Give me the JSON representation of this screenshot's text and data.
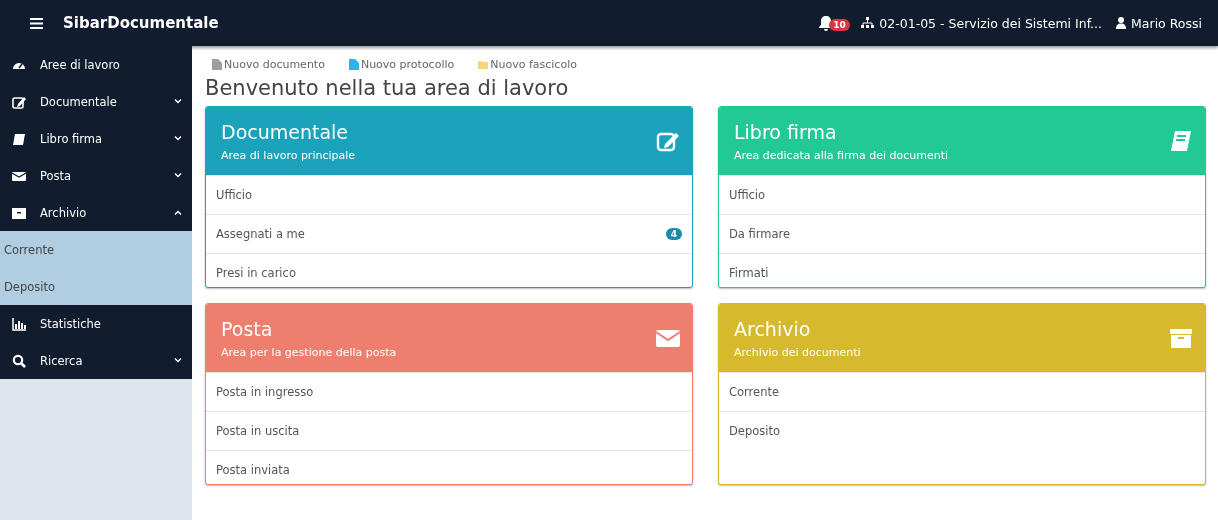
{
  "topbar": {
    "brand": "SibarDocumentale",
    "notifications": "10",
    "office": "02-01-05 - Servizio dei Sistemi Inf...",
    "user": "Mario Rossi"
  },
  "sidebar": {
    "items": [
      {
        "label": "Aree di lavoro"
      },
      {
        "label": "Documentale",
        "expanded": false
      },
      {
        "label": "Libro firma",
        "expanded": false
      },
      {
        "label": "Posta",
        "expanded": false
      },
      {
        "label": "Archivio",
        "expanded": true,
        "children": [
          {
            "label": "Corrente"
          },
          {
            "label": "Deposito"
          }
        ]
      },
      {
        "label": "Statistiche"
      },
      {
        "label": "Ricerca",
        "expanded": false
      }
    ]
  },
  "quick_actions": [
    {
      "label": "Nuovo documento",
      "color": "#9e9e9e"
    },
    {
      "label": "Nuovo protocollo",
      "color": "#29b6e6"
    },
    {
      "label": "Nuovo fascicolo",
      "color": "#f7d57a"
    }
  ],
  "heading": "Benvenuto nella tua area di lavoro",
  "cards": [
    {
      "title": "Documentale",
      "subtitle": "Area di lavoro principale",
      "color": "#1ba3bc",
      "rows": [
        {
          "label": "Ufficio"
        },
        {
          "label": "Assegnati a me",
          "badge": "4"
        },
        {
          "label": "Presi in carico"
        }
      ]
    },
    {
      "title": "Libro firma",
      "subtitle": "Area dedicata alla firma dei documenti",
      "color": "#22c994",
      "rows": [
        {
          "label": "Ufficio"
        },
        {
          "label": "Da firmare"
        },
        {
          "label": "Firmati"
        }
      ]
    },
    {
      "title": "Posta",
      "subtitle": "Area per la gestione della posta",
      "color": "#ee7f6f",
      "rows": [
        {
          "label": "Posta in ingresso"
        },
        {
          "label": "Posta in uscita"
        },
        {
          "label": "Posta inviata"
        }
      ]
    },
    {
      "title": "Archivio",
      "subtitle": "Archivio dei documenti",
      "color": "#d6b92c",
      "rows": [
        {
          "label": "Corrente"
        },
        {
          "label": "Deposito"
        }
      ]
    }
  ]
}
